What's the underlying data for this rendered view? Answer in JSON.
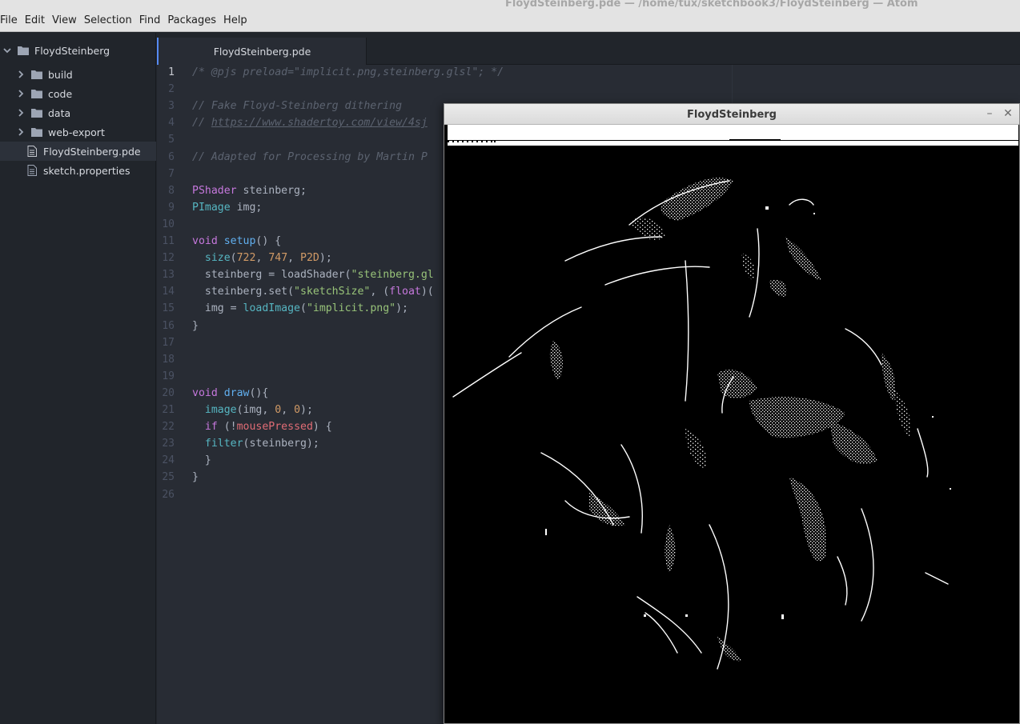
{
  "menubar": {
    "items": [
      "File",
      "Edit",
      "View",
      "Selection",
      "Find",
      "Packages",
      "Help"
    ],
    "window_title": "FloydSteinberg.pde — /home/tux/sketchbook3/FloydSteinberg — Atom"
  },
  "tree": {
    "root": "FloydSteinberg",
    "items": [
      {
        "label": "build",
        "kind": "folder"
      },
      {
        "label": "code",
        "kind": "folder"
      },
      {
        "label": "data",
        "kind": "folder"
      },
      {
        "label": "web-export",
        "kind": "folder"
      },
      {
        "label": "FloydSteinberg.pde",
        "kind": "file",
        "selected": true
      },
      {
        "label": "sketch.properties",
        "kind": "file"
      }
    ]
  },
  "tabs": [
    {
      "label": "FloydSteinberg.pde"
    }
  ],
  "editor": {
    "active_line": 1,
    "lines": [
      [
        {
          "t": "/* @pjs preload=\"implicit.png,steinberg.glsl\"; */",
          "c": "com"
        }
      ],
      [],
      [
        {
          "t": "// Fake Floyd-Steinberg dithering",
          "c": "com"
        }
      ],
      [
        {
          "t": "// ",
          "c": "com"
        },
        {
          "t": "https://www.shadertoy.com/view/4sj",
          "c": "link"
        }
      ],
      [],
      [
        {
          "t": "// Adapted for Processing by Martin P",
          "c": "com"
        }
      ],
      [],
      [
        {
          "t": "PShader",
          "c": "type"
        },
        {
          "t": " steinberg;",
          "c": "p"
        }
      ],
      [
        {
          "t": "PImage",
          "c": "bi"
        },
        {
          "t": " img;",
          "c": "p"
        }
      ],
      [],
      [
        {
          "t": "void",
          "c": "kw"
        },
        {
          "t": " ",
          "c": "p"
        },
        {
          "t": "setup",
          "c": "fn"
        },
        {
          "t": "() {",
          "c": "p"
        }
      ],
      [
        {
          "t": "  ",
          "c": "p"
        },
        {
          "t": "size",
          "c": "bi"
        },
        {
          "t": "(",
          "c": "p"
        },
        {
          "t": "722",
          "c": "num"
        },
        {
          "t": ", ",
          "c": "p"
        },
        {
          "t": "747",
          "c": "num"
        },
        {
          "t": ", ",
          "c": "p"
        },
        {
          "t": "P2D",
          "c": "num"
        },
        {
          "t": ");",
          "c": "p"
        }
      ],
      [
        {
          "t": "  steinberg = loadShader(",
          "c": "p"
        },
        {
          "t": "\"steinberg.gl",
          "c": "str"
        }
      ],
      [
        {
          "t": "  steinberg.set(",
          "c": "p"
        },
        {
          "t": "\"sketchSize\"",
          "c": "str"
        },
        {
          "t": ", (",
          "c": "p"
        },
        {
          "t": "float",
          "c": "kw"
        },
        {
          "t": ")(",
          "c": "p"
        }
      ],
      [
        {
          "t": "  img = ",
          "c": "p"
        },
        {
          "t": "loadImage",
          "c": "bi"
        },
        {
          "t": "(",
          "c": "p"
        },
        {
          "t": "\"implicit.png\"",
          "c": "str"
        },
        {
          "t": ");",
          "c": "p"
        }
      ],
      [
        {
          "t": "}",
          "c": "p"
        }
      ],
      [],
      [],
      [],
      [
        {
          "t": "void",
          "c": "kw"
        },
        {
          "t": " ",
          "c": "p"
        },
        {
          "t": "draw",
          "c": "fn"
        },
        {
          "t": "(){",
          "c": "p"
        }
      ],
      [
        {
          "t": "  ",
          "c": "p"
        },
        {
          "t": "image",
          "c": "bi"
        },
        {
          "t": "(img, ",
          "c": "p"
        },
        {
          "t": "0",
          "c": "num"
        },
        {
          "t": ", ",
          "c": "p"
        },
        {
          "t": "0",
          "c": "num"
        },
        {
          "t": ");",
          "c": "p"
        }
      ],
      [
        {
          "t": "  ",
          "c": "p"
        },
        {
          "t": "if",
          "c": "kw"
        },
        {
          "t": " (!",
          "c": "p"
        },
        {
          "t": "mousePressed",
          "c": "var"
        },
        {
          "t": ") {",
          "c": "p"
        }
      ],
      [
        {
          "t": "  ",
          "c": "p"
        },
        {
          "t": "filter",
          "c": "bi"
        },
        {
          "t": "(steinberg);",
          "c": "p"
        }
      ],
      [
        {
          "t": "  }",
          "c": "p"
        }
      ],
      [
        {
          "t": "}",
          "c": "p"
        }
      ],
      []
    ]
  },
  "sketch_window": {
    "title": "FloydSteinberg",
    "minimize": "–",
    "close": "✕"
  },
  "colors": {
    "accent": "#568af2",
    "editor_bg": "#282c34",
    "tree_bg": "#21252b"
  },
  "icons": [
    "chevron-right-icon",
    "chevron-down-icon",
    "folder-icon",
    "file-icon",
    "minimize-icon",
    "close-icon"
  ]
}
